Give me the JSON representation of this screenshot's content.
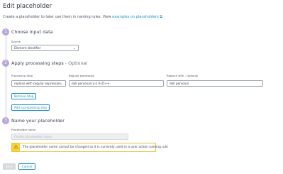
{
  "header": {
    "title": "Edit placeholder",
    "description": "Create a placeholder to later use them in naming rules. View ",
    "link_text": "examples on placeholders",
    "link_icon": "external-link-icon"
  },
  "steps": [
    {
      "number": "1",
      "title": "Choose input data",
      "optional": ""
    },
    {
      "number": "2",
      "title": "Apply processing steps",
      "optional": " - Optional"
    },
    {
      "number": "3",
      "title": "Name your placeholder",
      "optional": ""
    }
  ],
  "source": {
    "label": "Source",
    "value": "Element identifier"
  },
  "processing": {
    "step_label": "Processing Step",
    "step_value": "replace with regular expression",
    "regex_label": "Regular expression",
    "regex_value": "dall personal [a-z A-Z]++",
    "replace_label": "Replace with - Optional",
    "replace_value": "dall personal",
    "remove_label": "Remove Step",
    "add_label": "Add a processing step"
  },
  "name": {
    "label": "Placeholder name",
    "placeholder": "Create placeholder name",
    "warning": "The placeholder name cannot be changed as it is currently used in a user action naming rule"
  },
  "footer": {
    "save_label": "Save",
    "cancel_label": "Cancel"
  },
  "colors": {
    "accent": "#1f8fc4",
    "step": "#b8a5dc",
    "warning": "#f5d13d"
  }
}
